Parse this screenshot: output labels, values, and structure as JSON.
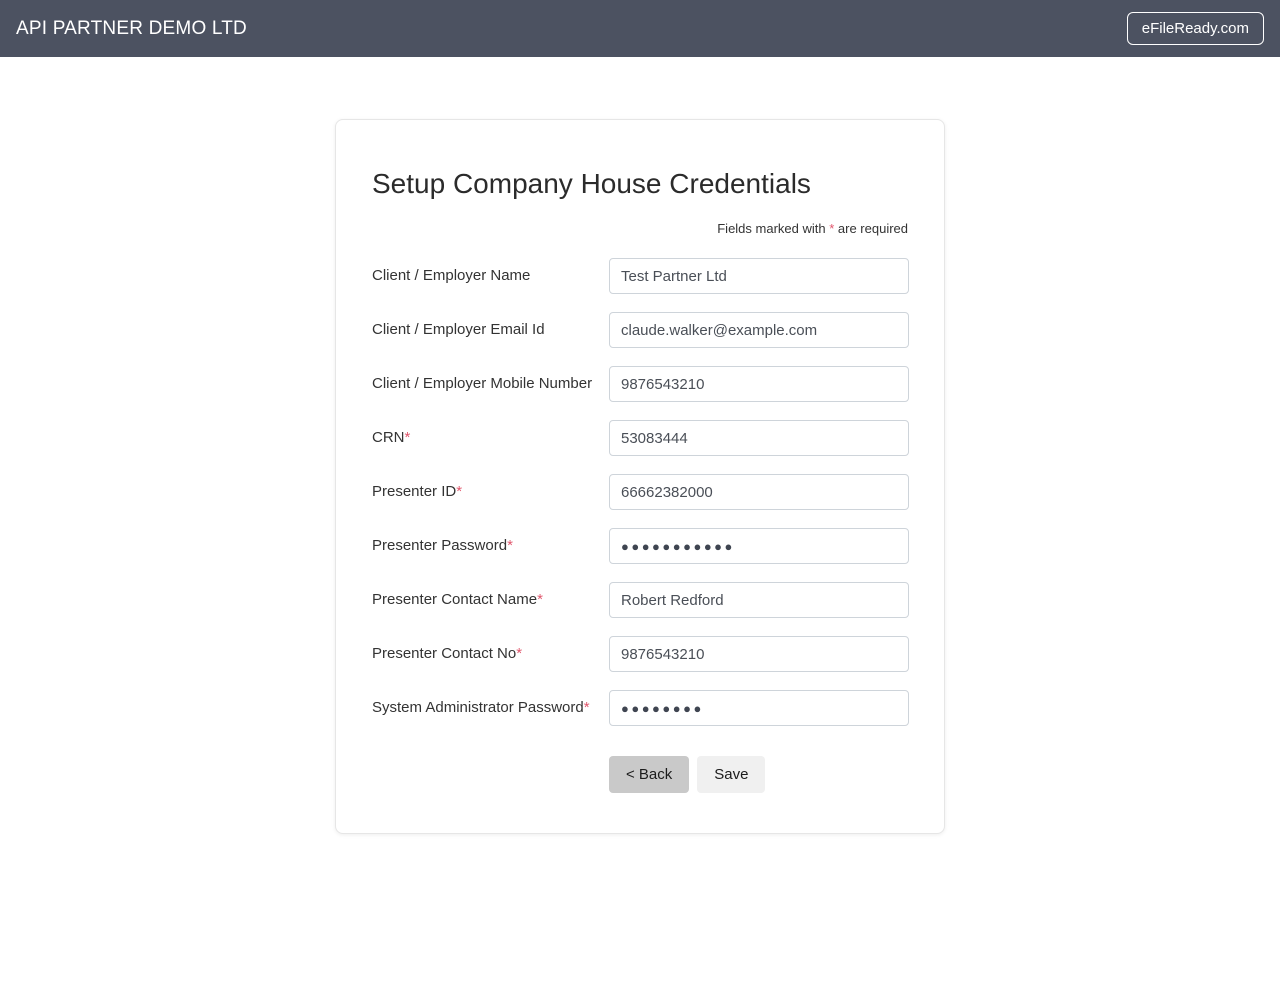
{
  "header": {
    "company_title": "API PARTNER DEMO LTD",
    "brand_button_label": "eFileReady.com",
    "background_color": "#4c5261",
    "text_color": "#ffffff"
  },
  "card": {
    "title": "Setup Company House Credentials",
    "required_note_prefix": "Fields marked with ",
    "required_note_asterisk": "*",
    "required_note_suffix": " are required",
    "required_marker_color": "#e0566c"
  },
  "form": {
    "fields": [
      {
        "label": "Client / Employer Name",
        "required": false,
        "type": "text",
        "value": "Test Partner Ltd"
      },
      {
        "label": "Client / Employer Email Id",
        "required": false,
        "type": "text",
        "value": "claude.walker@example.com"
      },
      {
        "label": "Client / Employer Mobile Number",
        "required": false,
        "type": "text",
        "value": "9876543210"
      },
      {
        "label": "CRN",
        "required": true,
        "type": "text",
        "value": "53083444"
      },
      {
        "label": "Presenter ID",
        "required": true,
        "type": "text",
        "value": "66662382000"
      },
      {
        "label": "Presenter Password",
        "required": true,
        "type": "password",
        "value": "●●●●●●●●●●●",
        "masked_length": 11
      },
      {
        "label": "Presenter Contact Name",
        "required": true,
        "type": "text",
        "value": "Robert Redford"
      },
      {
        "label": "Presenter Contact No",
        "required": true,
        "type": "text",
        "value": "9876543210"
      },
      {
        "label": "System Administrator Password",
        "required": true,
        "type": "password",
        "value": "●●●●●●●●",
        "masked_length": 8
      }
    ]
  },
  "actions": {
    "back_label": "< Back",
    "save_label": "Save"
  }
}
